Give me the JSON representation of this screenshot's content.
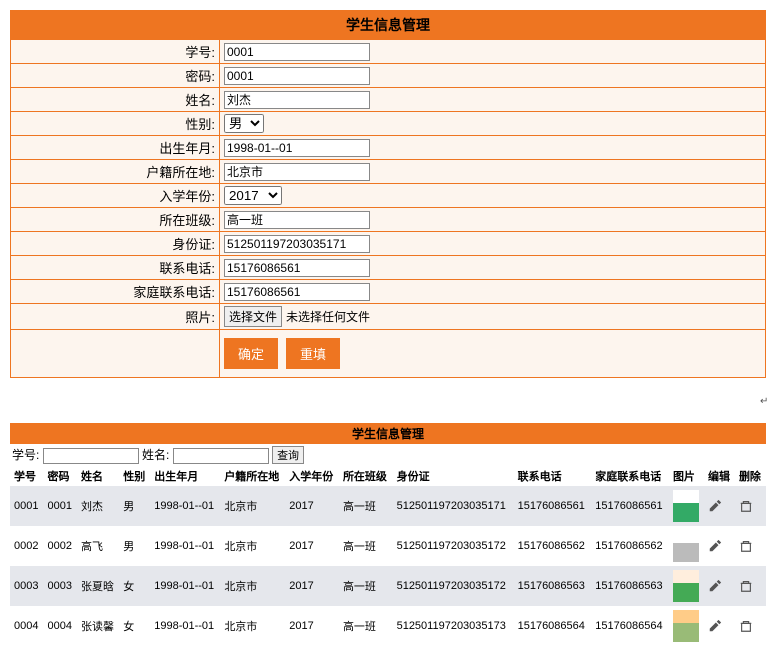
{
  "form": {
    "title": "学生信息管理",
    "labels": {
      "student_id": "学号:",
      "password": "密码:",
      "name": "姓名:",
      "gender": "性别:",
      "birth": "出生年月:",
      "hometown": "户籍所在地:",
      "enroll_year": "入学年份:",
      "class": "所在班级:",
      "id_card": "身份证:",
      "phone": "联系电话:",
      "family_phone": "家庭联系电话:",
      "photo": "照片:"
    },
    "values": {
      "student_id": "0001",
      "password": "0001",
      "name": "刘杰",
      "gender": "男",
      "birth": "1998-01--01",
      "hometown": "北京市",
      "enroll_year": "2017",
      "class": "高一班",
      "id_card": "512501197203035171",
      "phone": "15176086561",
      "family_phone": "15176086561"
    },
    "file_button": "选择文件",
    "file_status": "未选择任何文件",
    "submit": "确定",
    "reset": "重填"
  },
  "search": {
    "label_id": "学号:",
    "label_name": "姓名:",
    "button": "查询"
  },
  "list": {
    "title": "学生信息管理",
    "headers": [
      "学号",
      "密码",
      "姓名",
      "性别",
      "出生年月",
      "户籍所在地",
      "入学年份",
      "所在班级",
      "身份证",
      "联系电话",
      "家庭联系电话",
      "图片",
      "编辑",
      "删除"
    ],
    "rows": [
      {
        "id": "0001",
        "pwd": "0001",
        "name": "刘杰",
        "gender": "男",
        "birth": "1998-01--01",
        "home": "北京市",
        "year": "2017",
        "class": "高一班",
        "idc": "512501197203035171",
        "phone": "15176086561",
        "fphone": "15176086561",
        "avatar": "av1"
      },
      {
        "id": "0002",
        "pwd": "0002",
        "name": "高飞",
        "gender": "男",
        "birth": "1998-01--01",
        "home": "北京市",
        "year": "2017",
        "class": "高一班",
        "idc": "512501197203035172",
        "phone": "15176086562",
        "fphone": "15176086562",
        "avatar": "av2"
      },
      {
        "id": "0003",
        "pwd": "0003",
        "name": "张夏晗",
        "gender": "女",
        "birth": "1998-01--01",
        "home": "北京市",
        "year": "2017",
        "class": "高一班",
        "idc": "512501197203035172",
        "phone": "15176086563",
        "fphone": "15176086563",
        "avatar": "av3"
      },
      {
        "id": "0004",
        "pwd": "0004",
        "name": "张读馨",
        "gender": "女",
        "birth": "1998-01--01",
        "home": "北京市",
        "year": "2017",
        "class": "高一班",
        "idc": "512501197203035173",
        "phone": "15176086564",
        "fphone": "15176086564",
        "avatar": "av4"
      }
    ]
  }
}
